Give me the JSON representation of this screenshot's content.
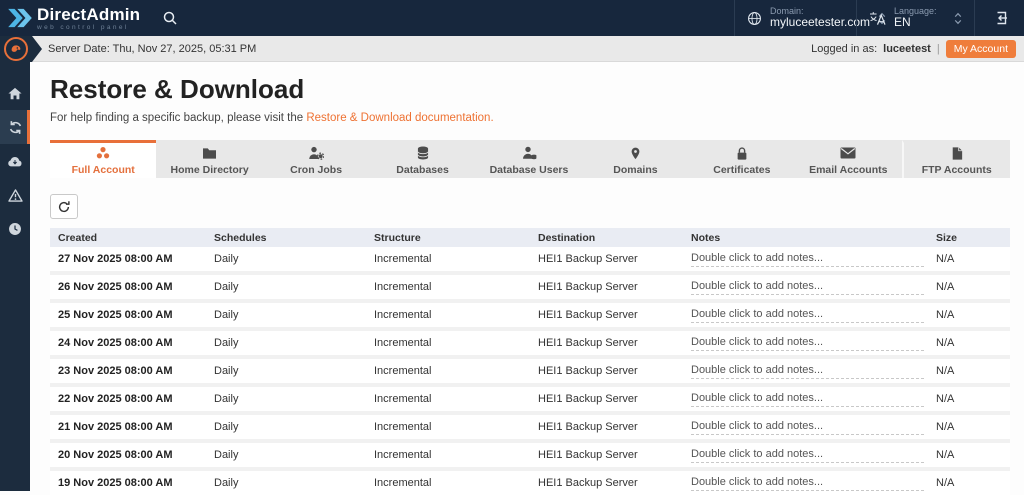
{
  "colors": {
    "accent": "#e8703a",
    "navbar": "#17273d",
    "sidebar": "#1c2c3e",
    "button_orange": "#ef7d3b",
    "link_orange": "#ee7233",
    "logo_blue": "#4db5e5"
  },
  "brand": {
    "name": "DirectAdmin",
    "tagline": "web control panel"
  },
  "topbar": {
    "domain": {
      "label": "Domain:",
      "value": "myluceetester.com"
    },
    "language": {
      "label": "Language:",
      "value": "EN"
    }
  },
  "statusbar": {
    "server_date": "Server Date: Thu, Nov 27, 2025, 05:31 PM",
    "logged_in_label": "Logged in as:",
    "username": "luceetest",
    "separator": "|",
    "my_account_label": "My Account"
  },
  "sidebar": {
    "items": [
      {
        "icon": "home-icon"
      },
      {
        "icon": "sync-icon",
        "active": true
      },
      {
        "icon": "cloud-download-icon"
      },
      {
        "icon": "warning-icon"
      },
      {
        "icon": "clock-icon"
      }
    ]
  },
  "page": {
    "title": "Restore & Download",
    "help_prefix": "For help finding a specific backup, please visit the ",
    "help_link": "Restore & Download documentation."
  },
  "tabs": [
    {
      "label": "Full Account",
      "icon": "full-account-icon",
      "active": true
    },
    {
      "label": "Home Directory",
      "icon": "folder-icon",
      "active": false
    },
    {
      "label": "Cron Jobs",
      "icon": "user-gear-icon",
      "active": false
    },
    {
      "label": "Databases",
      "icon": "database-icon",
      "active": false
    },
    {
      "label": "Database Users",
      "icon": "database-user-icon",
      "active": false
    },
    {
      "label": "Domains",
      "icon": "map-pin-icon",
      "active": false
    },
    {
      "label": "Certificates",
      "icon": "lock-icon",
      "active": false
    },
    {
      "label": "Email Accounts",
      "icon": "envelope-icon",
      "active": false
    },
    {
      "label": "FTP Accounts",
      "icon": "file-icon",
      "active": false
    }
  ],
  "table": {
    "columns": [
      "Created",
      "Schedules",
      "Structure",
      "Destination",
      "Notes",
      "Size"
    ],
    "rows": [
      {
        "created": "27 Nov 2025 08:00 AM",
        "schedules": "Daily",
        "structure": "Incremental",
        "destination": "HEI1 Backup Server",
        "notes": "Double click to add notes...",
        "size": "N/A"
      },
      {
        "created": "26 Nov 2025 08:00 AM",
        "schedules": "Daily",
        "structure": "Incremental",
        "destination": "HEI1 Backup Server",
        "notes": "Double click to add notes...",
        "size": "N/A"
      },
      {
        "created": "25 Nov 2025 08:00 AM",
        "schedules": "Daily",
        "structure": "Incremental",
        "destination": "HEI1 Backup Server",
        "notes": "Double click to add notes...",
        "size": "N/A"
      },
      {
        "created": "24 Nov 2025 08:00 AM",
        "schedules": "Daily",
        "structure": "Incremental",
        "destination": "HEI1 Backup Server",
        "notes": "Double click to add notes...",
        "size": "N/A"
      },
      {
        "created": "23 Nov 2025 08:00 AM",
        "schedules": "Daily",
        "structure": "Incremental",
        "destination": "HEI1 Backup Server",
        "notes": "Double click to add notes...",
        "size": "N/A"
      },
      {
        "created": "22 Nov 2025 08:00 AM",
        "schedules": "Daily",
        "structure": "Incremental",
        "destination": "HEI1 Backup Server",
        "notes": "Double click to add notes...",
        "size": "N/A"
      },
      {
        "created": "21 Nov 2025 08:00 AM",
        "schedules": "Daily",
        "structure": "Incremental",
        "destination": "HEI1 Backup Server",
        "notes": "Double click to add notes...",
        "size": "N/A"
      },
      {
        "created": "20 Nov 2025 08:00 AM",
        "schedules": "Daily",
        "structure": "Incremental",
        "destination": "HEI1 Backup Server",
        "notes": "Double click to add notes...",
        "size": "N/A"
      },
      {
        "created": "19 Nov 2025 08:00 AM",
        "schedules": "Daily",
        "structure": "Incremental",
        "destination": "HEI1 Backup Server",
        "notes": "Double click to add notes...",
        "size": "N/A"
      }
    ]
  }
}
